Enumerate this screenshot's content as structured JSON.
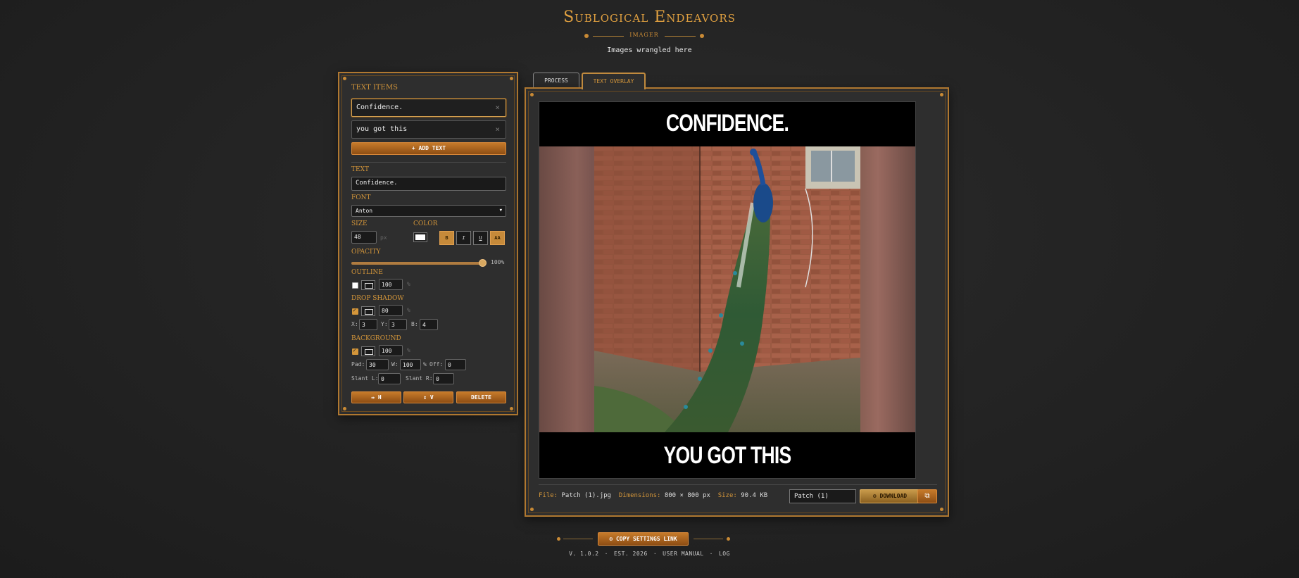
{
  "header": {
    "title": "Sublogical Endeavors",
    "subtitle": "IMAGER",
    "tagline": "Images wrangled here"
  },
  "text_items": {
    "heading": "TEXT ITEMS",
    "items": [
      {
        "label": "Confidence.",
        "selected": true
      },
      {
        "label": "you got this",
        "selected": false
      }
    ],
    "remove_glyph": "×",
    "add_button": "+ ADD TEXT"
  },
  "editor": {
    "text_label": "TEXT",
    "text_value": "Confidence.",
    "font_label": "FONT",
    "font_value": "Anton",
    "size_label": "SIZE",
    "size_value": "48",
    "size_unit": "px",
    "color_label": "COLOR",
    "color_value": "#ffffff",
    "format": {
      "bold": "B",
      "italic": "I",
      "underline": "U",
      "caps": "AA",
      "bold_on": true,
      "caps_on": true
    },
    "opacity_label": "OPACITY",
    "opacity_value": "100%",
    "opacity_fraction": 1.0,
    "outline_label": "OUTLINE",
    "outline_enabled": false,
    "outline_value": "100",
    "outline_unit": "%",
    "shadow_label": "DROP SHADOW",
    "shadow_enabled": true,
    "shadow_value": "80",
    "shadow_unit": "%",
    "shadow_x_label": "X:",
    "shadow_x": "3",
    "shadow_y_label": "Y:",
    "shadow_y": "3",
    "shadow_b_label": "B:",
    "shadow_b": "4",
    "background_label": "BACKGROUND",
    "background_enabled": true,
    "background_value": "100",
    "background_unit": "%",
    "pad_label": "Pad:",
    "pad_value": "30",
    "w_label": "W:",
    "w_value": "100",
    "w_unit": "%",
    "off_label": "Off:",
    "off_value": "0",
    "slant_l_label": "Slant L:",
    "slant_l_value": "0",
    "slant_r_label": "Slant R:",
    "slant_r_value": "0",
    "center_h": "↔ H",
    "center_v": "↕ V",
    "delete": "DELETE"
  },
  "tabs": [
    {
      "label": "PROCESS",
      "active": false
    },
    {
      "label": "TEXT OVERLAY",
      "active": true
    }
  ],
  "preview": {
    "caption_top": "CONFIDENCE.",
    "caption_bottom": "YOU GOT THIS"
  },
  "file_info": {
    "file_label": "File:",
    "file_value": "Patch (1).jpg",
    "dim_label": "Dimensions:",
    "dim_value": "800 × 800 px",
    "size_label": "Size:",
    "size_value": "90.4 KB",
    "name_value": "Patch (1)",
    "download": "⚙ DOWNLOAD",
    "copy_icon": "⧉"
  },
  "footer": {
    "copy_settings": "⚙ COPY SETTINGS LINK",
    "version": "V. 1.0.2",
    "est": "EST. 2026",
    "manual": "USER MANUAL",
    "log": "LOG",
    "sep": "·"
  },
  "colors": {
    "accent": "#d4963a",
    "border": "#b07830",
    "button": "#b06a20"
  }
}
